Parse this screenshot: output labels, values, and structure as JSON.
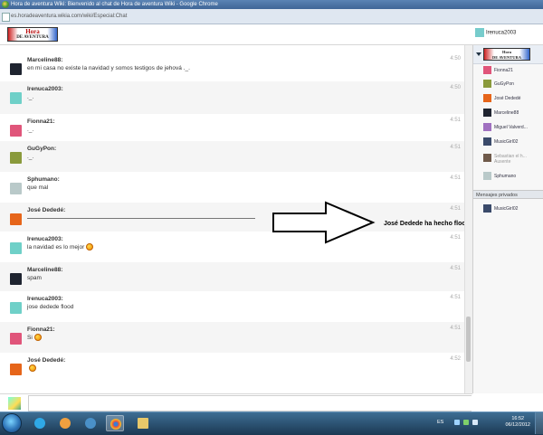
{
  "window": {
    "title": "Hora de aventura Wiki: Bienvenido al chat de Hora de aventura Wiki - Google Chrome"
  },
  "address_bar": {
    "url": "es.horadeaventura.wikia.com/wiki/Especial:Chat"
  },
  "header": {
    "logo_line1": "Hora",
    "logo_line2": "DE AVENTURA",
    "current_user": "Irenuca2003"
  },
  "messages": [
    {
      "nick": "Marceline88:",
      "text": "en mi casa no existe la navidad y somos testigos de jehová ._.",
      "time": "4:50",
      "avatar_color": "#1f2430"
    },
    {
      "nick": "Irenuca2003:",
      "text": "._.",
      "time": "4:50",
      "avatar_color": "#6fd0c8"
    },
    {
      "nick": "Fionna21:",
      "text": "._.",
      "time": "4:51",
      "avatar_color": "#e0557a"
    },
    {
      "nick": "GuGyPon:",
      "text": "._.",
      "time": "4:51",
      "avatar_color": "#8a9a3c"
    },
    {
      "nick": "Sphumano:",
      "text": "que mal",
      "time": "4:51",
      "avatar_color": "#b9c9c9"
    },
    {
      "nick": "José Dededé:",
      "text": "",
      "time": "4:51",
      "avatar_color": "#e6651a"
    },
    {
      "nick": "Irenuca2003:",
      "text": "la navidad es lo mejor",
      "time": "4:51",
      "avatar_color": "#6fd0c8"
    },
    {
      "nick": "Marceline88:",
      "text": "spam",
      "time": "4:51",
      "avatar_color": "#1f2430"
    },
    {
      "nick": "Irenuca2003:",
      "text": "jose dedede flood",
      "time": "4:51",
      "avatar_color": "#6fd0c8"
    },
    {
      "nick": "Fionna21:",
      "text": "Si",
      "time": "4:51",
      "avatar_color": "#e0557a"
    },
    {
      "nick": "José Dededé:",
      "text": "",
      "time": "4:52",
      "avatar_color": "#e6651a"
    }
  ],
  "annotation": {
    "text": "José Dedede ha hecho flood"
  },
  "sidebar": {
    "logo_line1": "Hora",
    "logo_line2": "DE AVENTURA",
    "users": [
      {
        "name": "Fionna21",
        "avatar_color": "#e0557a",
        "away": false
      },
      {
        "name": "GuGyPon",
        "avatar_color": "#8a9a3c",
        "away": false
      },
      {
        "name": "José Dededé",
        "avatar_color": "#e6651a",
        "away": false
      },
      {
        "name": "Marceline88",
        "avatar_color": "#1f2430",
        "away": false
      },
      {
        "name": "Miguel Valverd...",
        "avatar_color": "#a070c0",
        "away": false
      },
      {
        "name": "MusicGirl02",
        "avatar_color": "#3a4a6a",
        "away": false
      },
      {
        "name": "Sebastian el h...",
        "avatar_color": "#6f5a4a",
        "away": true,
        "status": "Ausente"
      },
      {
        "name": "Sphumano",
        "avatar_color": "#b9c9c9",
        "away": false
      }
    ],
    "private_header": "Mensajes privados",
    "private_users": [
      {
        "name": "MusicGirl02",
        "avatar_color": "#3a4a6a"
      }
    ]
  },
  "taskbar": {
    "lang": "ES",
    "time": "16:52",
    "date": "06/12/2012"
  },
  "colors": {
    "titlebar": "#4a73a5",
    "taskbar": "#1b3953",
    "text_gray": "#aaaaaa"
  }
}
